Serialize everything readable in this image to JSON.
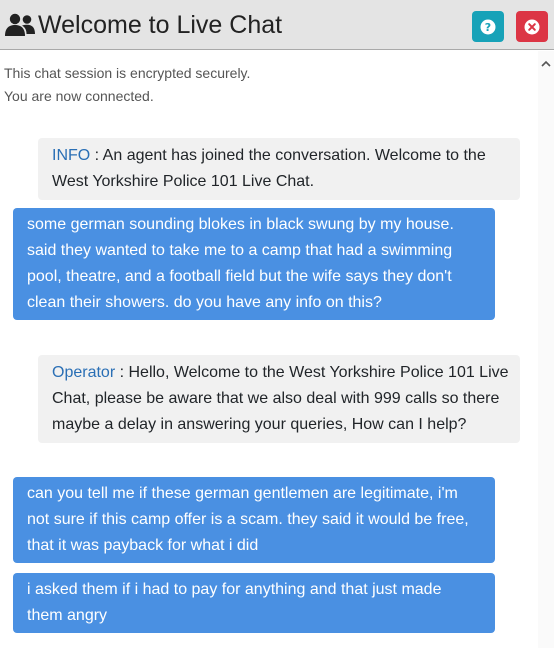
{
  "header": {
    "title": "Welcome to Live Chat",
    "help_icon": "question-circle-icon",
    "close_icon": "close-circle-icon",
    "user_icon": "users-icon"
  },
  "status": {
    "line1": "This chat session is encrypted securely.",
    "line2": "You are now connected."
  },
  "messages": [
    {
      "type": "system",
      "sender": "INFO",
      "separator": " : ",
      "text": "An agent has joined the conversation. Welcome to the West Yorkshire Police 101 Live Chat."
    },
    {
      "type": "user",
      "text": "some german sounding blokes in black swung by my house. said they wanted to take me to a camp that had a swimming pool, theatre, and a football field but the wife says they don't clean their showers. do you have any info on this?"
    },
    {
      "type": "system",
      "sender": "Operator",
      "separator": " : ",
      "text": "Hello, Welcome to the West Yorkshire Police 101 Live Chat, please be aware that we also deal with 999 calls so there maybe a delay in answering your queries, How can I help?"
    },
    {
      "type": "user",
      "text": "can you tell me if these german gentlemen are legitimate, i'm not sure if this camp offer is a scam. they said it would be free, that it was payback for what i did"
    },
    {
      "type": "user",
      "text": "i asked them if i had to pay for anything and that just made them angry"
    }
  ],
  "colors": {
    "header_bg": "#e4e4e4",
    "user_bubble": "#4a90e2",
    "system_bubble": "#f1f1f1",
    "sender_name": "#2a6fb5",
    "help_button": "#17a2b8",
    "close_button": "#dc3545"
  }
}
